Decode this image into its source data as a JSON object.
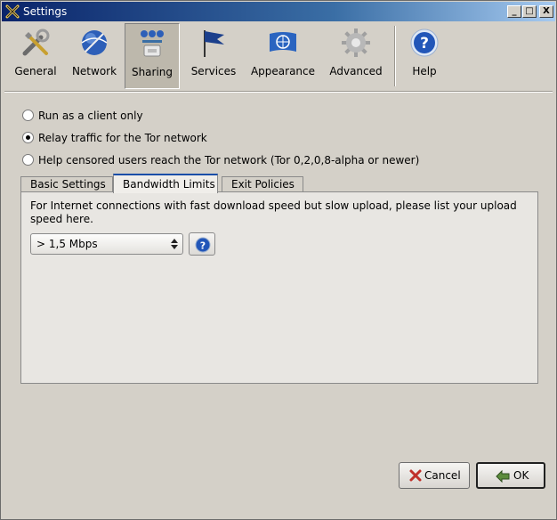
{
  "window": {
    "title": "Settings",
    "controls": {
      "minimize": "_",
      "maximize": "□",
      "close": "X"
    }
  },
  "toolbar": {
    "items": [
      {
        "label": "General",
        "icon": "tools-icon"
      },
      {
        "label": "Network",
        "icon": "globe-icon"
      },
      {
        "label": "Sharing",
        "icon": "sharing-icon",
        "selected": true
      },
      {
        "label": "Services",
        "icon": "flag-icon"
      },
      {
        "label": "Appearance",
        "icon": "un-flag-icon"
      },
      {
        "label": "Advanced",
        "icon": "gear-icon"
      },
      {
        "label": "Help",
        "icon": "help-icon"
      }
    ]
  },
  "mode": {
    "options": [
      {
        "label": "Run as a client only",
        "checked": false
      },
      {
        "label": "Relay traffic for the Tor network",
        "checked": true
      },
      {
        "label": "Help censored users reach the Tor network (Tor 0,2,0,8-alpha or newer)",
        "checked": false
      }
    ]
  },
  "tabs": {
    "items": [
      {
        "label": "Basic Settings"
      },
      {
        "label": "Bandwidth Limits",
        "selected": true
      },
      {
        "label": "Exit Policies"
      }
    ]
  },
  "bandwidth": {
    "description": "For Internet connections with fast download speed but slow upload, please list your upload speed here.",
    "selected_rate": "> 1,5 Mbps"
  },
  "buttons": {
    "cancel": "Cancel",
    "ok": "OK"
  },
  "colors": {
    "title_bar": "#0a246a",
    "accent_blue": "#1a4ea8",
    "window_bg": "#d4d0c8"
  }
}
